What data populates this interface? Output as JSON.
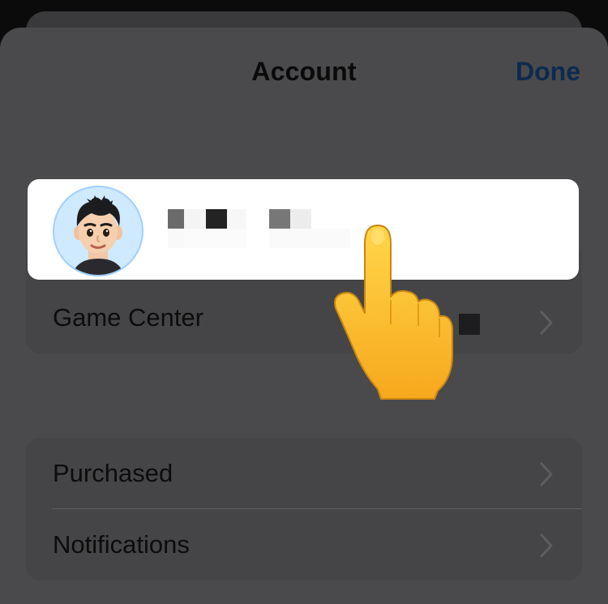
{
  "header": {
    "title": "Account",
    "done_label": "Done"
  },
  "account_card": {
    "avatar_icon": "memoji-avatar-icon",
    "name_redacted": true
  },
  "groups": [
    {
      "rows": [
        {
          "label": "Game Center",
          "icon": "chevron-right-icon"
        }
      ]
    },
    {
      "rows": [
        {
          "label": "Purchased",
          "icon": "chevron-right-icon"
        },
        {
          "label": "Notifications",
          "icon": "chevron-right-icon"
        }
      ]
    }
  ],
  "overlay": {
    "icon": "pointing-hand-icon"
  },
  "colors": {
    "accent": "#0e2a4e",
    "sheet_bg": "#4a4a4c",
    "card_bg": "#ffffff",
    "pointer_yellow": "#ffc83d"
  }
}
